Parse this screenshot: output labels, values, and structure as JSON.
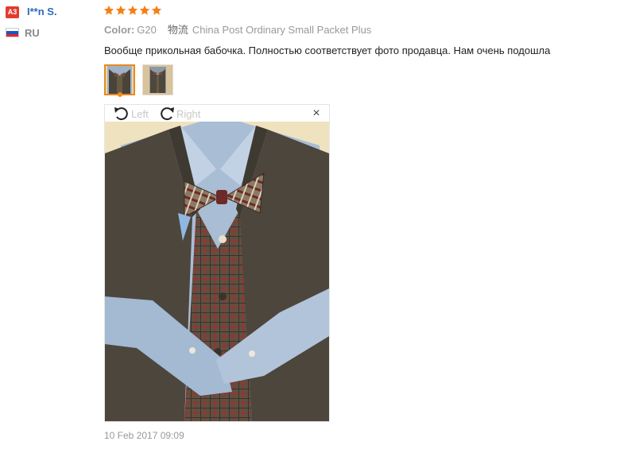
{
  "user": {
    "level_badge": "A3",
    "name": "I**n S.",
    "country_code": "RU"
  },
  "review": {
    "rating": 5,
    "color_label": "Color:",
    "color_value": "G20",
    "logistics_label": "物流",
    "logistics_value": "China Post Ordinary Small Packet Plus",
    "text": "Вообще прикольная бабочка. Полностью соответствует фото продавца. Нам очень подошла",
    "date": "10 Feb 2017 09:09"
  },
  "viewer": {
    "rotate_left_label": "Left",
    "rotate_right_label": "Right",
    "close_label": "×"
  },
  "colors": {
    "star": "#f57f17",
    "user_name": "#2b6cb8",
    "level_badge": "#e43b2c",
    "thumb_active_border": "#e88a1e"
  },
  "icons": {
    "rotate_left": "rotate-left-icon",
    "rotate_right": "rotate-right-icon",
    "close": "close-icon",
    "star": "star-icon",
    "flag": "russia-flag-icon"
  }
}
